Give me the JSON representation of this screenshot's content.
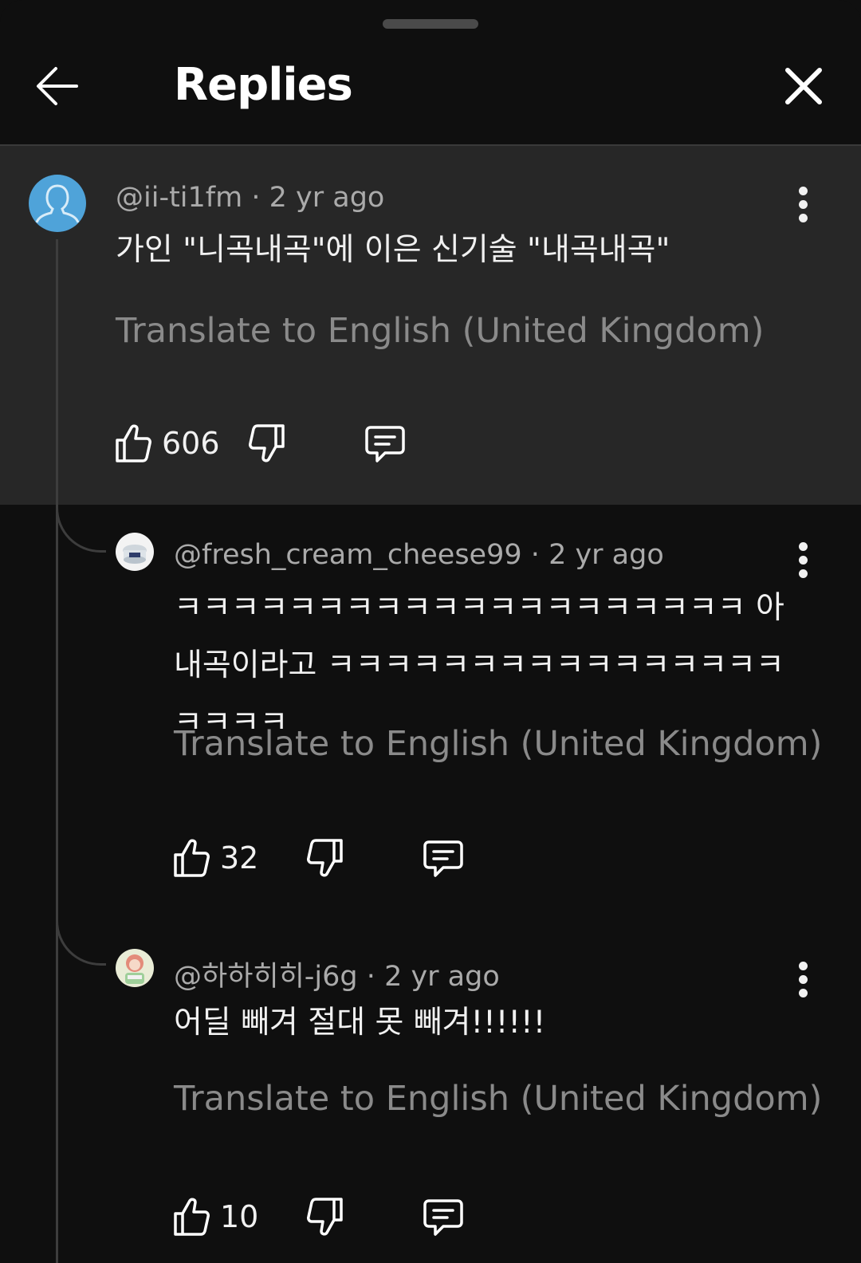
{
  "header": {
    "title": "Replies",
    "back_icon": "arrow-left-icon",
    "close_icon": "close-icon"
  },
  "comments": [
    {
      "author": "@ii-ti1fm",
      "time": "2 yr ago",
      "text": "가인 \"니곡내곡\"에 이은 신기술 \"내곡내곡\"",
      "translate_label": "Translate to English (United Kingdom)",
      "likes": "606"
    },
    {
      "author": "@fresh_cream_cheese99",
      "time": "2 yr ago",
      "text": "ㅋㅋㅋㅋㅋㅋㅋㅋㅋㅋㅋㅋㅋㅋㅋㅋㅋㅋㅋㅋ 아 내곡이라고 ㅋㅋㅋㅋㅋㅋㅋㅋㅋㅋㅋㅋㅋㅋㅋㅋㅋㅋㅋㅋ",
      "translate_label": "Translate to English (United Kingdom)",
      "likes": "32"
    },
    {
      "author": "@하하히히-j6g",
      "time": "2 yr ago",
      "text": "어딜 빼겨 절대 못 빼겨!!!!!!",
      "translate_label": "Translate to English (United Kingdom)",
      "likes": "10"
    }
  ],
  "separator": "·",
  "colors": {
    "background": "#0f0f0f",
    "highlight": "#272727",
    "default_avatar": "#4fa3d9"
  }
}
